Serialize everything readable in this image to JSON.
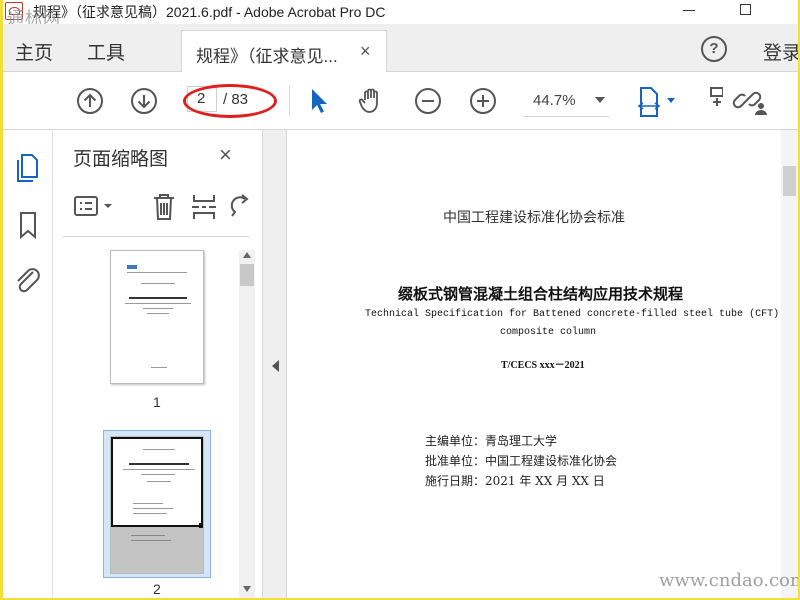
{
  "window": {
    "title": "规程》（征求意见稿）2021.6.pdf - Adobe Acrobat Pro DC",
    "watermark_top": "通标网"
  },
  "menu": {
    "home": "主页",
    "tools": "工具",
    "doc_tab": "规程》（征求意见...",
    "doc_tab_close": "×",
    "help": "?",
    "login": "登录"
  },
  "toolbar": {
    "current_page": "2",
    "total_pages": "/ 83",
    "zoom": "44.7%"
  },
  "thumbnails_panel": {
    "title": "页面缩略图",
    "close": "×",
    "pages": [
      {
        "number": "1",
        "selected": false
      },
      {
        "number": "2",
        "selected": true
      }
    ]
  },
  "document": {
    "org": "中国工程建设标准化协会标准",
    "title_cn": "缀板式钢管混凝土组合柱结构应用技术规程",
    "title_en_line1": "Technical Specification for Battened concrete-filled steel tube (CFT)",
    "title_en_line2": "composite column",
    "code": "T/CECS xxx－2021",
    "meta": [
      "主编单位：青岛理工大学",
      "批准单位：中国工程建设标准化协会",
      "施行日期：2021 年 XX 月 XX 日"
    ]
  },
  "watermark_bottom": "www.cndao.com",
  "colors": {
    "accent": "#1565c0",
    "annotation": "#e02020",
    "background_border": "#f2df3a"
  }
}
